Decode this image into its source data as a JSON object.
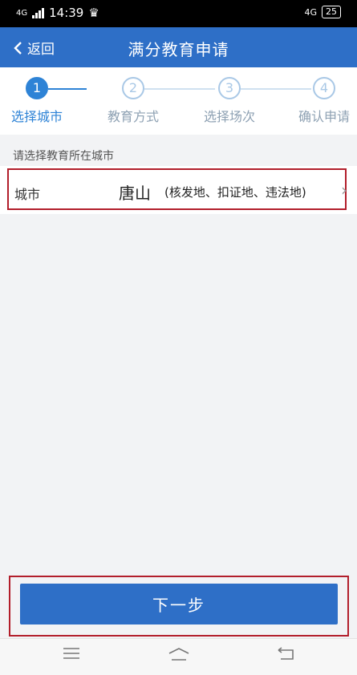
{
  "statusbar": {
    "network": "4G",
    "time": "14:39",
    "right_network": "4G",
    "battery": "25"
  },
  "titlebar": {
    "back_label": "返回",
    "title": "满分教育申请"
  },
  "steps": [
    {
      "number": "1",
      "label": "选择城市",
      "active": true
    },
    {
      "number": "2",
      "label": "教育方式",
      "active": false
    },
    {
      "number": "3",
      "label": "选择场次",
      "active": false
    },
    {
      "number": "4",
      "label": "确认申请",
      "active": false
    }
  ],
  "form": {
    "hint": "请选择教育所在城市",
    "city_label": "城市",
    "city_value": "唐山",
    "city_note": "(核发地、扣证地、违法地)"
  },
  "next_button": "下一步",
  "colors": {
    "accent": "#2e6fc7",
    "step_active": "#2e83d6",
    "highlight_frame": "#b21e2b"
  },
  "icons": [
    "crown-icon",
    "back-chevron-icon",
    "chevron-right-icon",
    "menu-icon",
    "home-icon",
    "back-nav-icon"
  ]
}
